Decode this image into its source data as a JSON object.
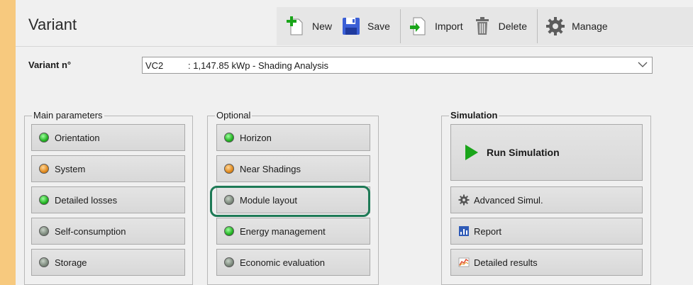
{
  "header": {
    "title": "Variant"
  },
  "toolbar": {
    "new_label": "New",
    "save_label": "Save",
    "import_label": "Import",
    "delete_label": "Delete",
    "manage_label": "Manage"
  },
  "variant": {
    "label": "Variant n°",
    "code": "VC2",
    "description": ": 1,147.85 kWp - Shading Analysis"
  },
  "main_parameters": {
    "title": "Main parameters",
    "items": [
      {
        "label": "Orientation",
        "status": "green"
      },
      {
        "label": "System",
        "status": "orange"
      },
      {
        "label": "Detailed losses",
        "status": "green"
      },
      {
        "label": "Self-consumption",
        "status": "gray"
      },
      {
        "label": "Storage",
        "status": "gray"
      }
    ]
  },
  "optional": {
    "title": "Optional",
    "items": [
      {
        "label": "Horizon",
        "status": "green"
      },
      {
        "label": "Near Shadings",
        "status": "orange"
      },
      {
        "label": "Module layout",
        "status": "gray"
      },
      {
        "label": "Energy management",
        "status": "green"
      },
      {
        "label": "Economic evaluation",
        "status": "gray"
      }
    ]
  },
  "simulation": {
    "title": "Simulation",
    "run_label": "Run Simulation",
    "advanced_label": "Advanced Simul.",
    "report_label": "Report",
    "detailed_label": "Detailed results"
  },
  "colors": {
    "stripe": "#f7c97e",
    "led_green": "#22b222",
    "led_orange": "#e08a1e",
    "led_gray": "#7d8a7d",
    "highlight": "#1e7a56"
  }
}
